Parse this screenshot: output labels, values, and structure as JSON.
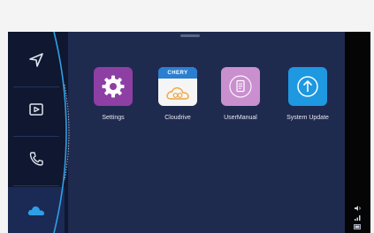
{
  "colors": {
    "background": "#1f2a4f",
    "sidebar": "#0f1830",
    "sidebar_active": "#1b2a55",
    "accent_blue": "#2f9fe6",
    "settings_tile": "#8e3fa4",
    "cloudrive_tile": "#f5f5f5",
    "usermanual_tile": "#c98fcf",
    "system_update_tile": "#1e98e0"
  },
  "sidebar": {
    "items": [
      {
        "name": "navigation",
        "icon": "navigation-arrow-icon",
        "active": false
      },
      {
        "name": "media",
        "icon": "play-box-icon",
        "active": false
      },
      {
        "name": "phone",
        "icon": "phone-icon",
        "active": false
      },
      {
        "name": "cloud",
        "icon": "cloud-icon",
        "active": true
      }
    ]
  },
  "apps": [
    {
      "label": "Settings",
      "icon": "gear-icon"
    },
    {
      "label": "Cloudrive",
      "icon": "cloud-link-icon",
      "badge": "CHERY"
    },
    {
      "label": "UserManual",
      "icon": "manual-book-icon"
    },
    {
      "label": "System Update",
      "icon": "upload-arrow-icon"
    }
  ],
  "status_tray": {
    "icons": [
      "volume-icon",
      "signal-icon",
      "battery-icon"
    ]
  }
}
